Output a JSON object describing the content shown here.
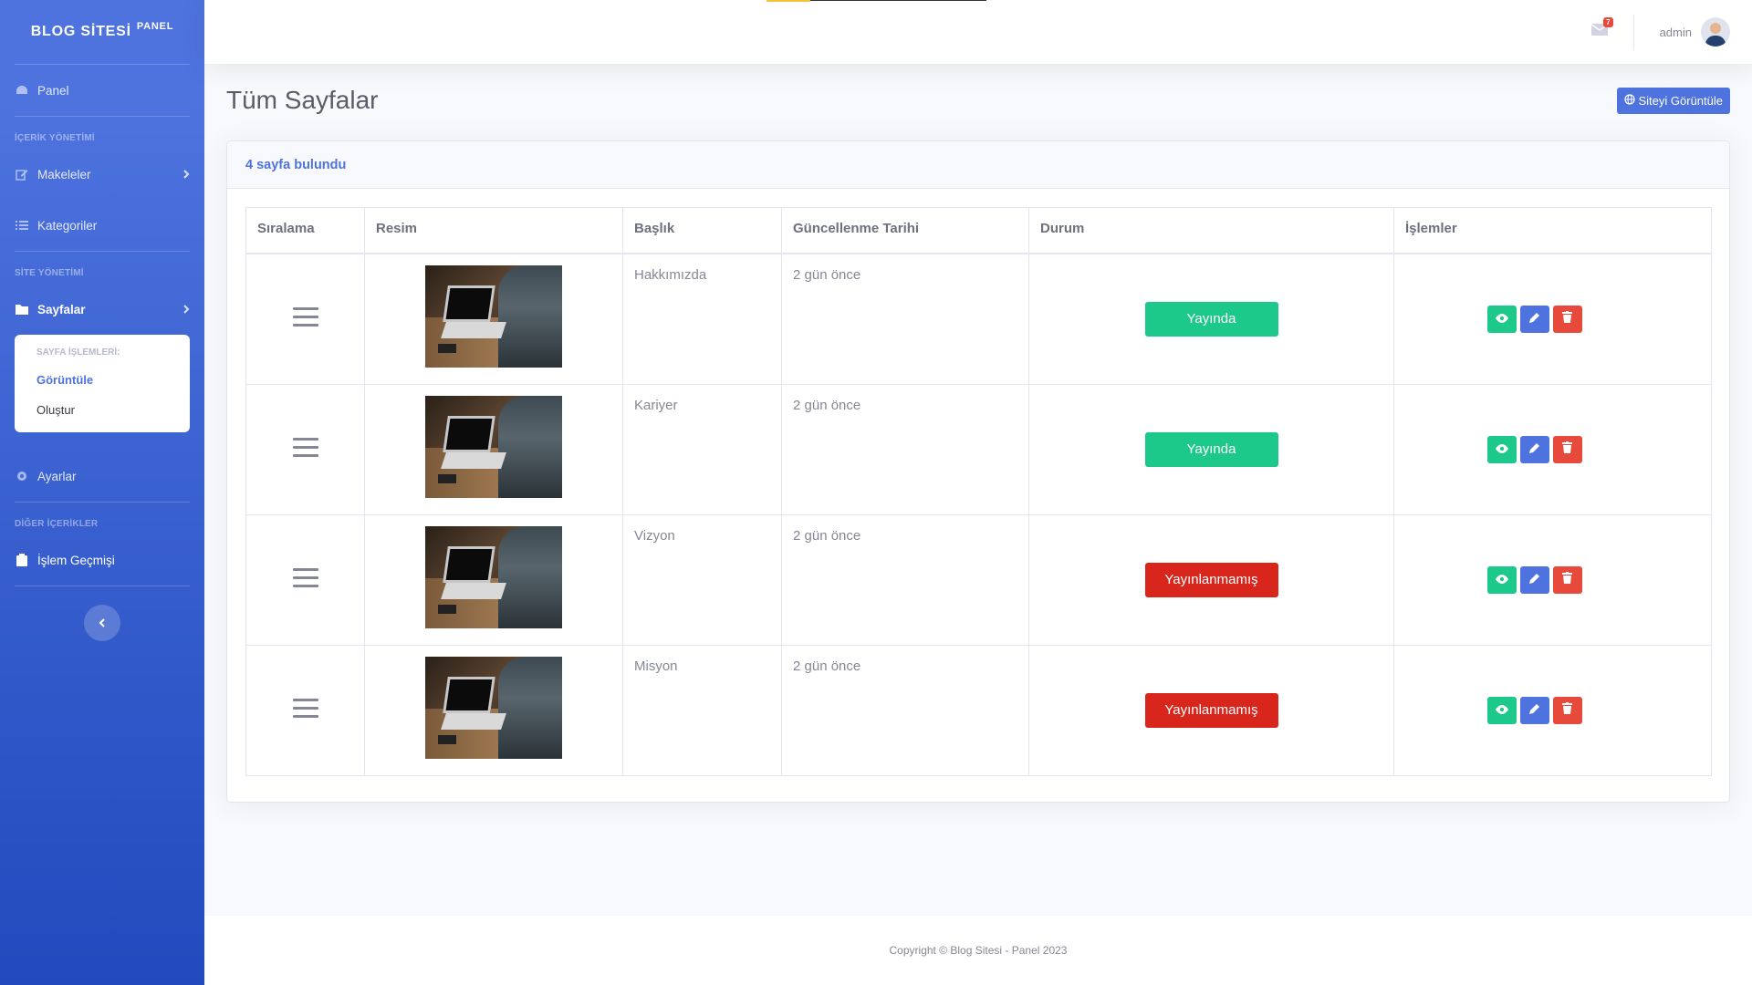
{
  "brand": {
    "name": "BLOG SİTESİ",
    "sup": "PANEL"
  },
  "sidebar": {
    "panel": "Panel",
    "section_content": "İÇERİK YÖNETİMİ",
    "articles": "Makeleler",
    "categories": "Kategoriler",
    "section_site": "SİTE YÖNETİMİ",
    "pages": "Sayfalar",
    "submenu": {
      "header": "SAYFA İŞLEMLERİ:",
      "view": "Görüntüle",
      "create": "Oluştur"
    },
    "settings": "Ayarlar",
    "section_other": "DİĞER İÇERİKLER",
    "history": "İşlem Geçmişi",
    "toggle_icon": "chevron-left-icon"
  },
  "topbar": {
    "mail_count": "7",
    "user": "admin"
  },
  "page": {
    "title": "Tüm Sayfalar",
    "site_button": "Siteyi Görüntüle"
  },
  "card": {
    "title": "4 sayfa bulundu"
  },
  "table": {
    "headers": [
      "Sıralama",
      "Resim",
      "Başlık",
      "Güncellenme Tarihi",
      "Durum",
      "İşlemler"
    ],
    "rows": [
      {
        "title": "Hakkımızda",
        "updated": "2 gün önce",
        "status": "Yayında",
        "published": true
      },
      {
        "title": "Kariyer",
        "updated": "2 gün önce",
        "status": "Yayında",
        "published": true
      },
      {
        "title": "Vizyon",
        "updated": "2 gün önce",
        "status": "Yayınlanmamış",
        "published": false
      },
      {
        "title": "Misyon",
        "updated": "2 gün önce",
        "status": "Yayınlanmamış",
        "published": false
      }
    ]
  },
  "colors": {
    "primary": "#4e73df",
    "success": "#1cc88a",
    "danger": "#e74a3b"
  },
  "footer": "Copyright © Blog Sitesi - Panel 2023"
}
